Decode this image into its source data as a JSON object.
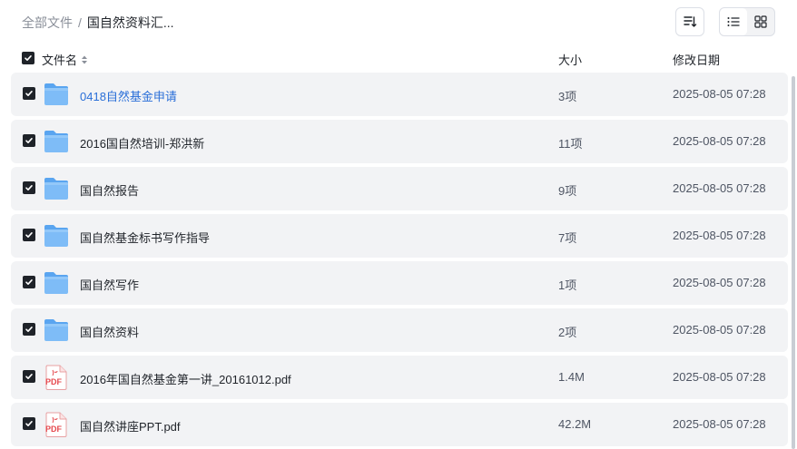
{
  "breadcrumb": {
    "root": "全部文件",
    "separator": "/",
    "current": "国自然资料汇..."
  },
  "toolbar": {
    "sort_icon": "sort-icon",
    "list_view_icon": "list-view-icon",
    "grid_view_icon": "grid-view-icon",
    "active_view": "list"
  },
  "columns": {
    "name": "文件名",
    "size": "大小",
    "modified": "修改日期"
  },
  "files": [
    {
      "name": "0418自然基金申请",
      "size": "3项",
      "date": "2025-08-05 07:28",
      "type": "folder",
      "checked": true
    },
    {
      "name": "2016国自然培训-郑洪新",
      "size": "11项",
      "date": "2025-08-05 07:28",
      "type": "folder",
      "checked": true
    },
    {
      "name": "国自然报告",
      "size": "9项",
      "date": "2025-08-05 07:28",
      "type": "folder",
      "checked": true
    },
    {
      "name": "国自然基金标书写作指导",
      "size": "7项",
      "date": "2025-08-05 07:28",
      "type": "folder",
      "checked": true
    },
    {
      "name": "国自然写作",
      "size": "1项",
      "date": "2025-08-05 07:28",
      "type": "folder",
      "checked": true
    },
    {
      "name": "国自然资料",
      "size": "2项",
      "date": "2025-08-05 07:28",
      "type": "folder",
      "checked": true
    },
    {
      "name": "2016年国自然基金第一讲_20161012.pdf",
      "size": "1.4M",
      "date": "2025-08-05 07:28",
      "type": "pdf",
      "checked": true
    },
    {
      "name": "国自然讲座PPT.pdf",
      "size": "42.2M",
      "date": "2025-08-05 07:28",
      "type": "pdf",
      "checked": true
    }
  ],
  "icons": {
    "folder": "folder-icon",
    "pdf": "pdf-icon",
    "checkbox": "checkbox-checked-icon",
    "sort_toggle": "sort-toggle-icon"
  },
  "pdf_badge": "PDF",
  "colors": {
    "row_bg": "#f2f3f5",
    "link": "#2a6fd8",
    "folder": "#6fb3f5",
    "pdf_red": "#e5484d",
    "checkbox": "#1f2329"
  }
}
